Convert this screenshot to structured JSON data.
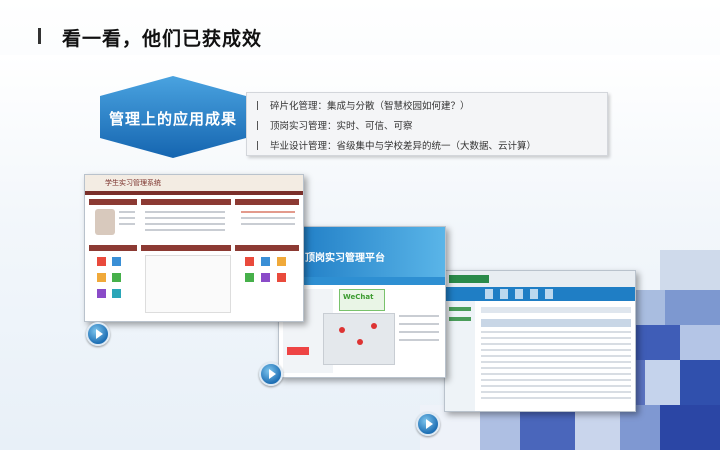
{
  "title": "看一看，他们已获成效",
  "label": "管理上的应用成果",
  "bullets": [
    "碎片化管理：集成与分散（智慧校园如何建？）",
    "顶岗实习管理：实时、可信、可察",
    "毕业设计管理：省级集中与学校差异的统一（大数据、云计算）"
  ],
  "screens": {
    "portal_header": "学生实习管理系统",
    "internship_banner": "顶岗实习管理平台",
    "wechat_label": "WeChat"
  },
  "colors": {
    "accent": "#1f7ec5",
    "portal": "#7a2f2a",
    "banner": "#1a78c2"
  }
}
